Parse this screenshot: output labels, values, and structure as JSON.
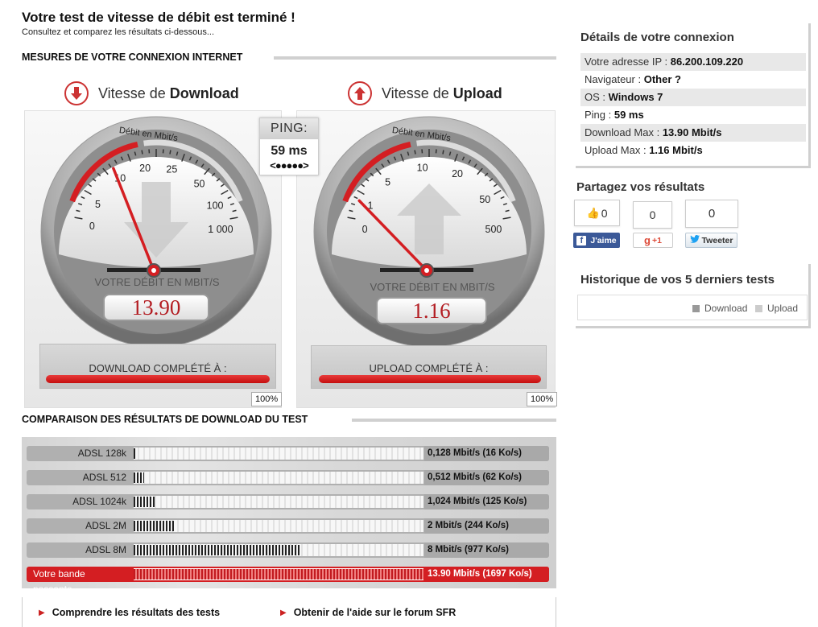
{
  "header": {
    "title": "Votre test de vitesse de débit est terminé !",
    "subtitle": "Consultez et comparez les résultats ci-dessous..."
  },
  "measures": {
    "section_title": "MESURES DE VOTRE CONNEXION INTERNET",
    "download": {
      "heading_prefix": "Vitesse de",
      "heading_bold": "Download",
      "dial_title": "Débit en Mbit/s",
      "ticks": [
        "0",
        "5",
        "10",
        "20",
        "25",
        "50",
        "100",
        "1 000"
      ],
      "needle_value": "10",
      "readout_label": "VOTRE DÉBIT EN MBIT/S",
      "readout_value": "13.90",
      "complete_label": "DOWNLOAD COMPLÉTÉ À :",
      "complete_percent": "100%",
      "progress": 1.0
    },
    "upload": {
      "heading_prefix": "Vitesse de",
      "heading_bold": "Upload",
      "dial_title": "Débit en Mbit/s",
      "ticks": [
        "0",
        "1",
        "5",
        "10",
        "20",
        "50",
        "500"
      ],
      "needle_value": "1",
      "readout_label": "VOTRE DÉBIT EN MBIT/S",
      "readout_value": "1.16",
      "complete_label": "UPLOAD COMPLÉTÉ À :",
      "complete_percent": "100%",
      "progress": 1.0
    },
    "ping": {
      "title": "PING:",
      "value": "59 ms",
      "dots": "<●●●●●>"
    }
  },
  "comparison": {
    "section_title": "COMPARAISON DES RÉSULTATS DE DOWNLOAD DU TEST",
    "rows": [
      {
        "label": "ADSL 128k",
        "value": "0,128 Mbit/s (16 Ko/s)",
        "mbits": 0.128,
        "highlight": false
      },
      {
        "label": "ADSL 512",
        "value": "0,512 Mbit/s (62 Ko/s)",
        "mbits": 0.512,
        "highlight": false
      },
      {
        "label": "ADSL 1024k",
        "value": "1,024 Mbit/s (125 Ko/s)",
        "mbits": 1.024,
        "highlight": false
      },
      {
        "label": "ADSL 2M",
        "value": "2 Mbit/s (244 Ko/s)",
        "mbits": 2,
        "highlight": false
      },
      {
        "label": "ADSL 8M",
        "value": "8 Mbit/s (977 Ko/s)",
        "mbits": 8,
        "highlight": false
      },
      {
        "label": "Votre bande passante",
        "value": "13.90 Mbit/s (1697 Ko/s)",
        "mbits": 13.9,
        "highlight": true
      }
    ]
  },
  "links": {
    "understand": "Comprendre les résultats des tests",
    "help": "Obtenir de l'aide sur le forum SFR"
  },
  "details": {
    "heading": "Détails de votre connexion",
    "rows": [
      {
        "label": "Votre adresse IP :",
        "value": "86.200.109.220"
      },
      {
        "label": "Navigateur :",
        "value": "Other ?"
      },
      {
        "label": "OS :",
        "value": "Windows 7"
      },
      {
        "label": "Ping :",
        "value": "59 ms"
      },
      {
        "label": "Download Max :",
        "value": "13.90 Mbit/s"
      },
      {
        "label": "Upload Max :",
        "value": "1.16 Mbit/s"
      }
    ]
  },
  "share": {
    "heading": "Partagez vos résultats",
    "facebook_count": "0",
    "facebook_label": "J'aime",
    "gplus_count": "0",
    "gplus_label": "+1",
    "twitter_count": "0",
    "twitter_label": "Tweeter"
  },
  "history": {
    "heading": "Historique de vos 5 derniers tests",
    "legend_download": "Download",
    "legend_upload": "Upload"
  },
  "colors": {
    "accent_red": "#d41e22",
    "facebook_blue": "#3b5998",
    "twitter_blue": "#1da1f2",
    "legend_download": "#999999",
    "legend_upload": "#cccccc"
  }
}
